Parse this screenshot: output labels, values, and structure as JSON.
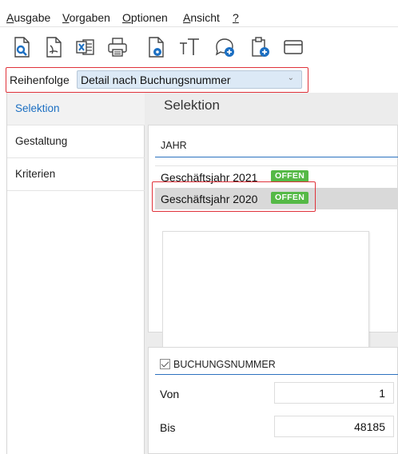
{
  "menu": {
    "items": [
      {
        "label": "Ausgabe",
        "accel": "A",
        "rest": "usgabe"
      },
      {
        "label": "Vorgaben",
        "accel": "V",
        "rest": "orgaben"
      },
      {
        "label": "Optionen",
        "accel": "O",
        "rest": "ptionen"
      },
      {
        "label": "Ansicht",
        "accel": "A",
        "rest": "nsicht"
      },
      {
        "label": "?",
        "accel": "?",
        "rest": ""
      }
    ]
  },
  "toolbar": {
    "icons": [
      "print-preview-icon",
      "pdf-export-icon",
      "excel-export-icon",
      "printer-icon",
      "page-settings-icon",
      "font-size-icon",
      "comment-add-icon",
      "clipboard-add-icon",
      "window-icon"
    ],
    "accent": "#1c6fc2"
  },
  "order": {
    "label": "Reihenfolge",
    "value": "Detail nach Buchungsnummer"
  },
  "sidebar": {
    "items": [
      {
        "label": "Selektion",
        "active": true
      },
      {
        "label": "Gestaltung",
        "active": false
      },
      {
        "label": "Kriterien",
        "active": false
      }
    ]
  },
  "main": {
    "title": "Selektion",
    "jahr": {
      "header": "JAHR",
      "rows": [
        {
          "label": "Geschäftsjahr 2021",
          "badge": "OFFEN",
          "selected": false
        },
        {
          "label": "Geschäftsjahr 2020",
          "badge": "OFFEN",
          "selected": true
        }
      ]
    },
    "buchungsnummer": {
      "header": "BUCHUNGSNUMMER",
      "checked": true,
      "von_label": "Von",
      "von_value": "1",
      "bis_label": "Bis",
      "bis_value": "48185"
    }
  },
  "colors": {
    "highlight_border": "#e0323a",
    "badge_green": "#55b946",
    "select_bg": "#dce9f6"
  }
}
